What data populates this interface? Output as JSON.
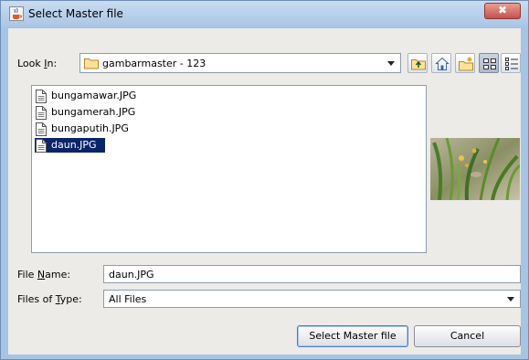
{
  "dialog": {
    "title": "Select Master file",
    "close_label": "✖"
  },
  "look_in": {
    "label_pre": "Look ",
    "label_mnemonic": "I",
    "label_post": "n:",
    "value": "gambarmaster - 123"
  },
  "toolbar": {
    "buttons": [
      "up-one-level",
      "home",
      "new-folder",
      "list-view",
      "details-view"
    ],
    "active": "list-view"
  },
  "files": [
    {
      "name": "bungamawar.JPG",
      "selected": false
    },
    {
      "name": "bungamerah.JPG",
      "selected": false
    },
    {
      "name": "bungaputih.JPG",
      "selected": false
    },
    {
      "name": "daun.JPG",
      "selected": true
    }
  ],
  "file_name": {
    "label_pre": "File ",
    "label_mnemonic": "N",
    "label_post": "ame:",
    "value": "daun.JPG"
  },
  "files_of_type": {
    "label_pre": "Files of ",
    "label_mnemonic": "T",
    "label_post": "ype:",
    "value": "All Files"
  },
  "buttons": {
    "approve": "Select Master file",
    "cancel": "Cancel"
  },
  "colors": {
    "selection": "#0a246a",
    "window_frame": "#a7c4e2",
    "client_bg": "#ecebe7"
  }
}
